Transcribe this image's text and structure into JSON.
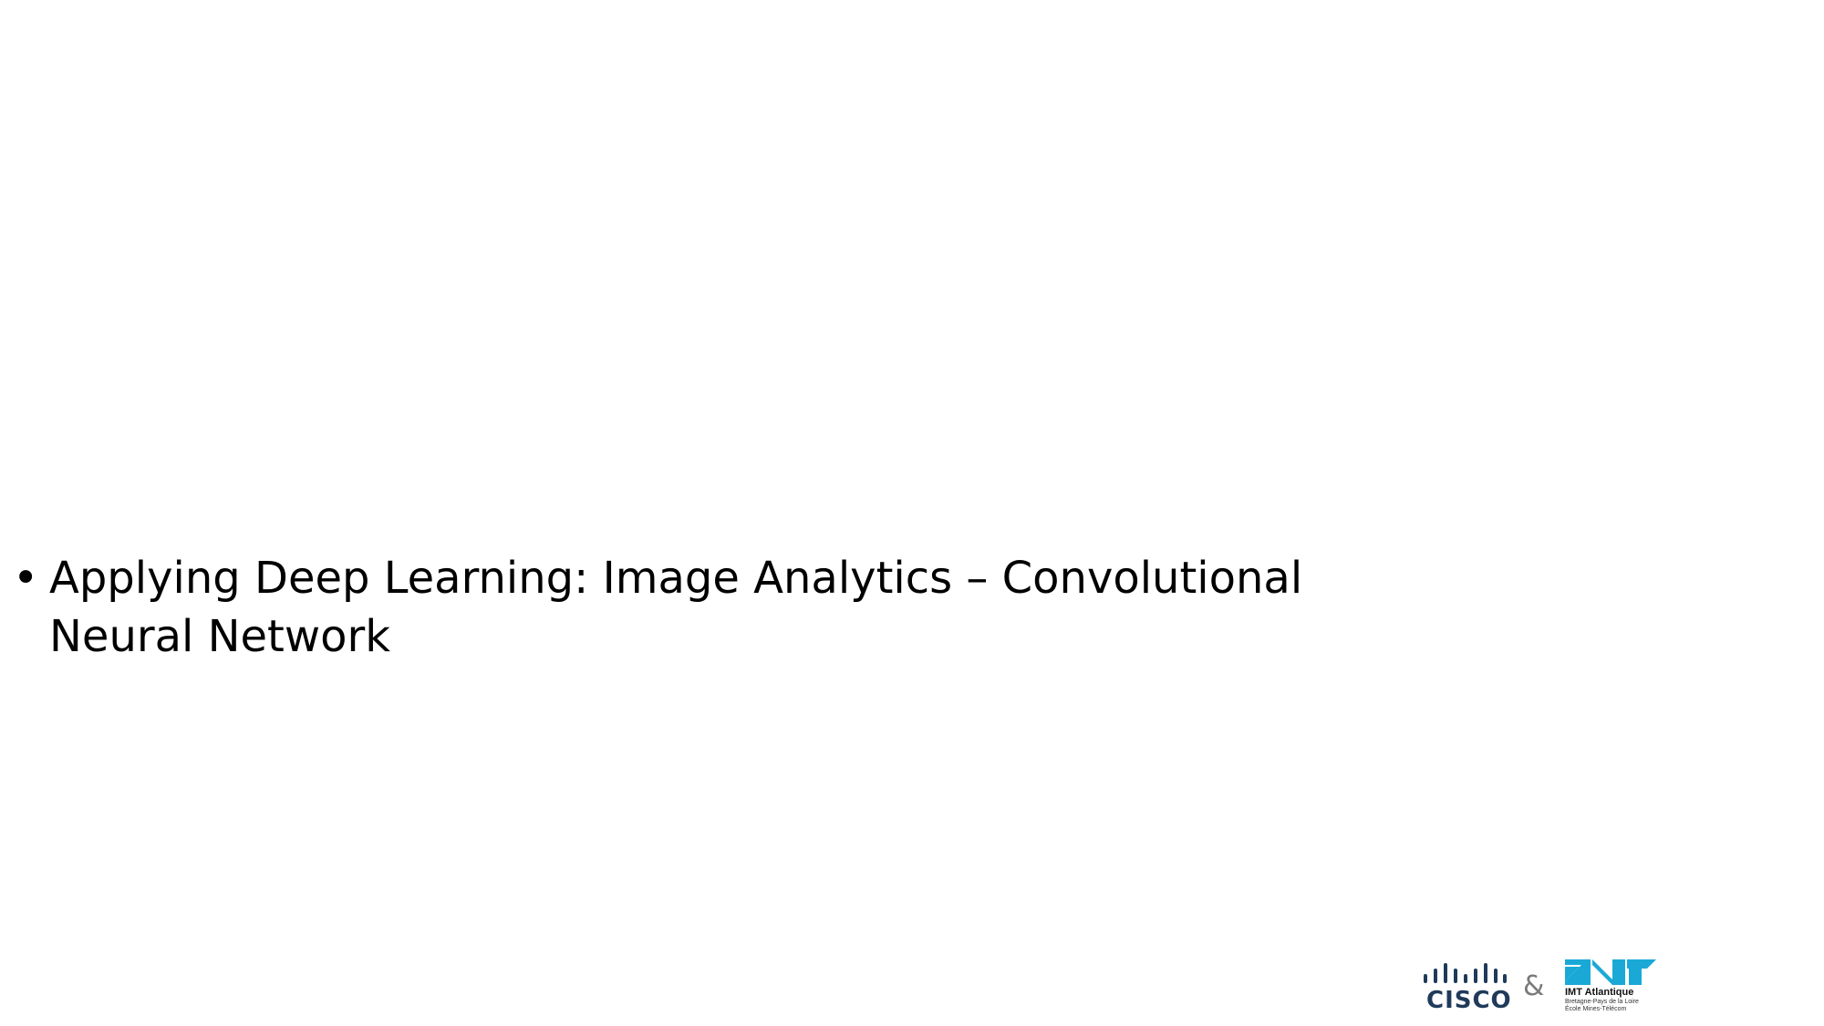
{
  "slide": {
    "bullet": {
      "symbol": "•",
      "lines": [
        "Applying Deep Learning: Image Analytics – Convolutional",
        "Neural Network"
      ]
    }
  },
  "footer": {
    "cisco": {
      "icon": "cisco-bars-icon",
      "wordmark": "CISCO",
      "color": "#1f3a5a"
    },
    "ampersand": "&",
    "imt": {
      "icon": "imt-mark-icon",
      "name": "IMT Atlantique",
      "subtitle_1": "Bretagne-Pays de la Loire",
      "subtitle_2": "École Mines-Télécom",
      "color": "#1aa9d6"
    }
  }
}
